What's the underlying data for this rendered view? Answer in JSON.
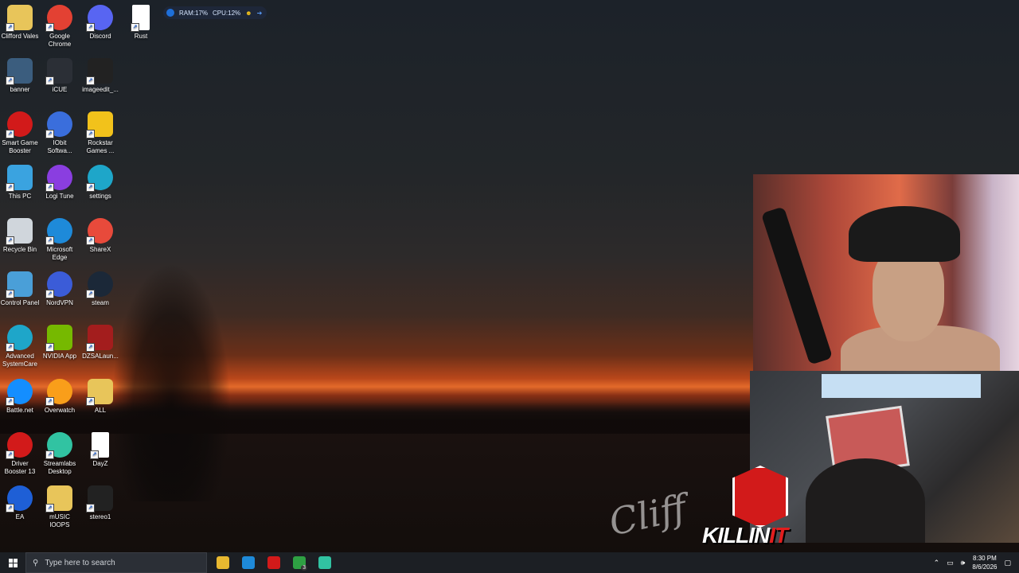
{
  "widget": {
    "ram": "RAM:17%",
    "cpu": "CPU:12%"
  },
  "desktop_icons": [
    {
      "label": "Clifford Vales",
      "icon": "folder-user-icon",
      "color": "#e8c55a"
    },
    {
      "label": "Google Chrome",
      "icon": "chrome-icon",
      "color": "#e34133"
    },
    {
      "label": "Discord",
      "icon": "discord-icon",
      "color": "#5865f2"
    },
    {
      "label": "Rust",
      "icon": "file-icon",
      "color": "#ffffff"
    },
    {
      "label": "banner",
      "icon": "image-icon",
      "color": "#3b5d7e"
    },
    {
      "label": "iCUE",
      "icon": "icue-icon",
      "color": "#2b2f36"
    },
    {
      "label": "imageedit_...",
      "icon": "image-icon",
      "color": "#222222"
    },
    {
      "label": "Smart Game Booster",
      "icon": "game-booster-icon",
      "color": "#d21a1a"
    },
    {
      "label": "IObit Softwa...",
      "icon": "iobit-icon",
      "color": "#3a6edc"
    },
    {
      "label": "Rockstar Games ...",
      "icon": "rockstar-icon",
      "color": "#f2c21b"
    },
    {
      "label": "This PC",
      "icon": "computer-icon",
      "color": "#3aa3e0"
    },
    {
      "label": "Logi Tune",
      "icon": "logitune-icon",
      "color": "#8a3ee0"
    },
    {
      "label": "settings",
      "icon": "edge-icon",
      "color": "#1ea6c9"
    },
    {
      "label": "Recycle Bin",
      "icon": "recycle-bin-icon",
      "color": "#d0d6dc"
    },
    {
      "label": "Microsoft Edge",
      "icon": "edge-icon",
      "color": "#1e8ad9"
    },
    {
      "label": "ShareX",
      "icon": "sharex-icon",
      "color": "#e84a3b"
    },
    {
      "label": "Control Panel",
      "icon": "control-panel-icon",
      "color": "#4a9fd8"
    },
    {
      "label": "NordVPN",
      "icon": "nordvpn-icon",
      "color": "#3b5cd8"
    },
    {
      "label": "steam",
      "icon": "steam-icon",
      "color": "#1b2838"
    },
    {
      "label": "Advanced SystemCare",
      "icon": "systemcare-icon",
      "color": "#1ea6c9"
    },
    {
      "label": "NVIDIA App",
      "icon": "nvidia-icon",
      "color": "#76b900"
    },
    {
      "label": "DZSALaun...",
      "icon": "dzsa-icon",
      "color": "#a31d1d"
    },
    {
      "label": "Battle.net",
      "icon": "battlenet-icon",
      "color": "#148eff"
    },
    {
      "label": "Overwatch",
      "icon": "overwatch-icon",
      "color": "#f99e1a"
    },
    {
      "label": "ALL",
      "icon": "folder-icon",
      "color": "#e8c55a"
    },
    {
      "label": "Driver Booster 13",
      "icon": "driver-booster-icon",
      "color": "#d21a1a"
    },
    {
      "label": "Streamlabs Desktop",
      "icon": "streamlabs-icon",
      "color": "#31c3a2"
    },
    {
      "label": "DayZ",
      "icon": "file-icon",
      "color": "#ffffff"
    },
    {
      "label": "EA",
      "icon": "ea-icon",
      "color": "#1e5fd6"
    },
    {
      "label": "mUSIC lOOPS",
      "icon": "folder-icon",
      "color": "#e8c55a"
    },
    {
      "label": "stereo1",
      "icon": "image-icon",
      "color": "#222222"
    }
  ],
  "overlay": {
    "logo_word": "KILLIN",
    "logo_word_accent": "IT",
    "signature": "Cliff"
  },
  "taskbar": {
    "search_placeholder": "Type here to search",
    "apps": [
      {
        "name": "file-explorer-icon",
        "color": "#e8b830"
      },
      {
        "name": "edge-icon",
        "color": "#1e8ad9"
      },
      {
        "name": "game-booster-icon",
        "color": "#d21a1a"
      },
      {
        "name": "xbox-icon",
        "color": "#2ea043",
        "badge": "3"
      },
      {
        "name": "streamlabs-icon",
        "color": "#31c3a2"
      }
    ],
    "time": "8:30 PM",
    "date": "8/6/2026"
  }
}
